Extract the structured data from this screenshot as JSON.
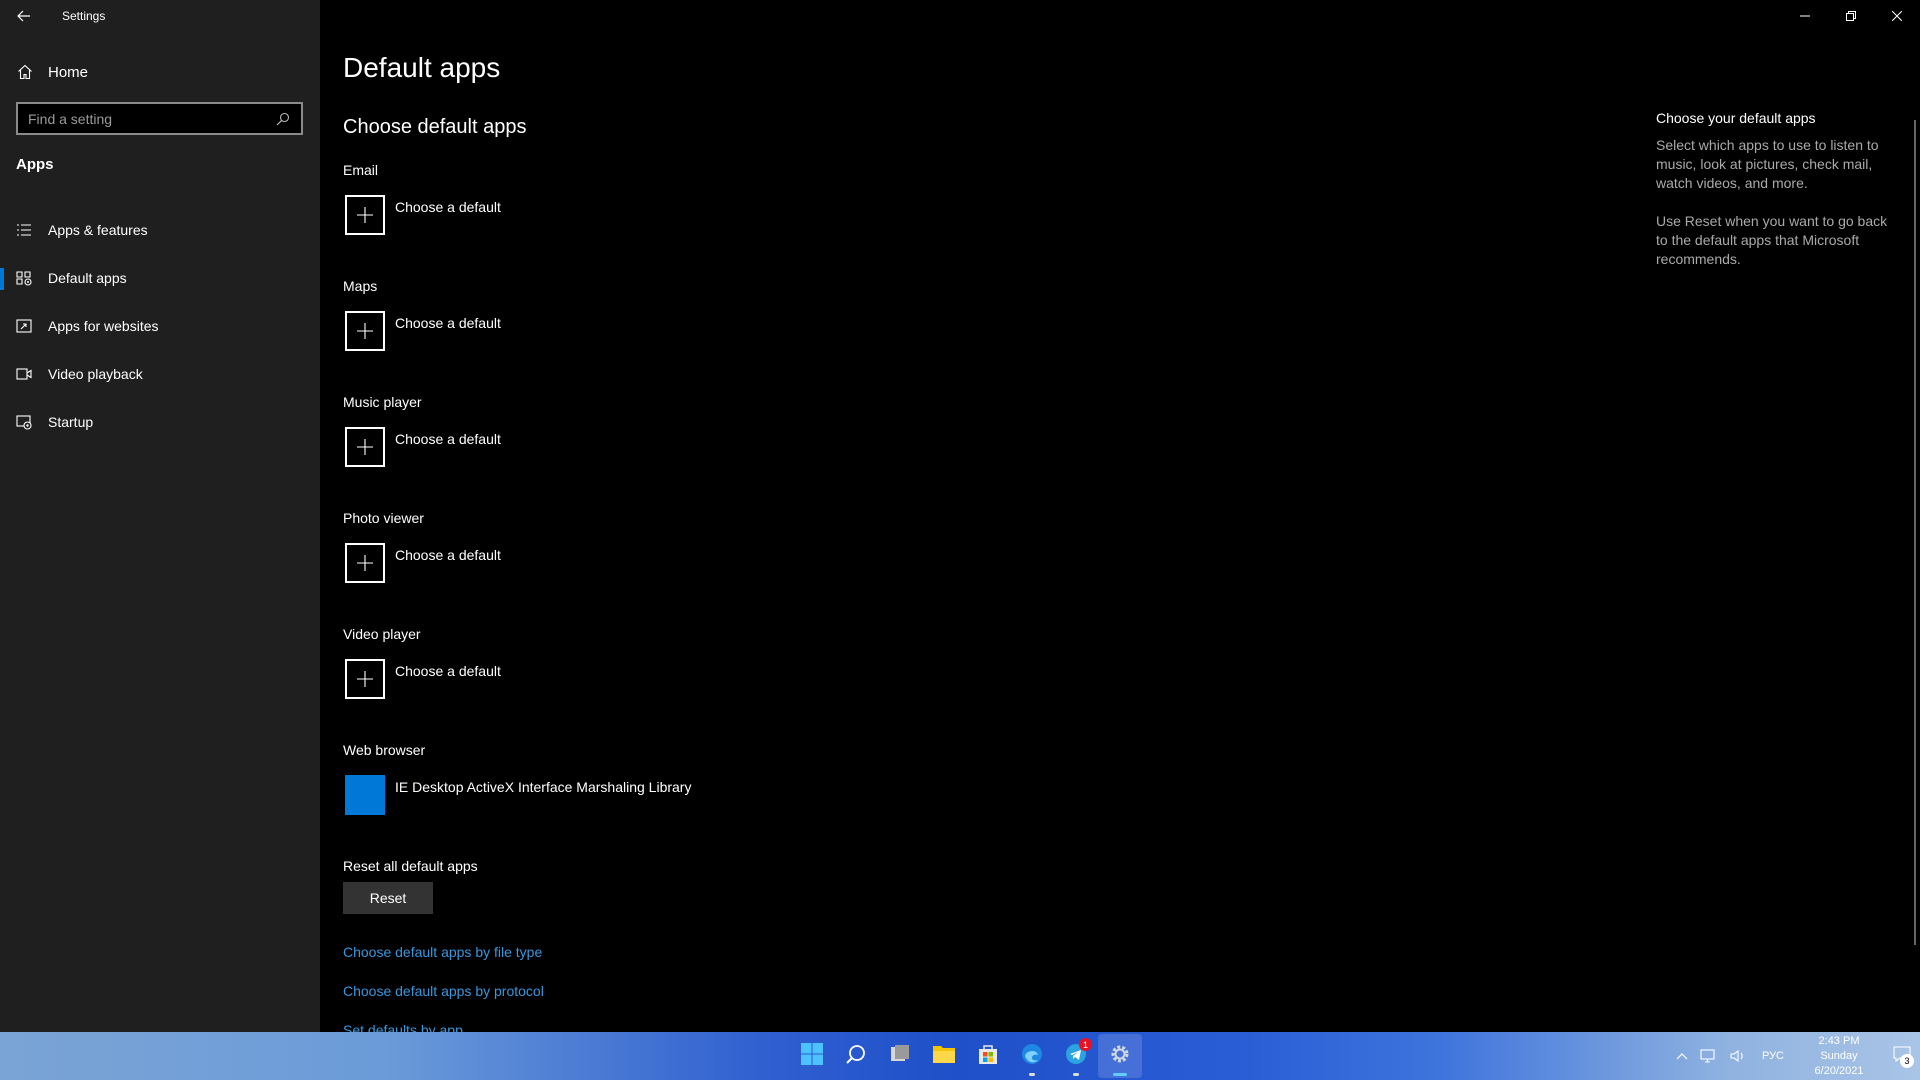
{
  "window": {
    "title": "Settings"
  },
  "sidebar": {
    "home_label": "Home",
    "search_placeholder": "Find a setting",
    "section_heading": "Apps",
    "items": [
      {
        "label": "Apps & features",
        "icon": "list-icon"
      },
      {
        "label": "Default apps",
        "icon": "default-apps-icon",
        "active": true
      },
      {
        "label": "Apps for websites",
        "icon": "open-link-icon"
      },
      {
        "label": "Video playback",
        "icon": "video-icon"
      },
      {
        "label": "Startup",
        "icon": "startup-icon"
      }
    ]
  },
  "main": {
    "title": "Default apps",
    "subtitle": "Choose default apps",
    "categories": [
      {
        "label": "Email",
        "value": "Choose a default"
      },
      {
        "label": "Maps",
        "value": "Choose a default"
      },
      {
        "label": "Music player",
        "value": "Choose a default"
      },
      {
        "label": "Photo viewer",
        "value": "Choose a default"
      },
      {
        "label": "Video player",
        "value": "Choose a default"
      },
      {
        "label": "Web browser",
        "value": "IE Desktop ActiveX Interface Marshaling Library"
      }
    ],
    "reset_label": "Reset all default apps",
    "reset_button": "Reset",
    "links": [
      "Choose default apps by file type",
      "Choose default apps by protocol",
      "Set defaults by app"
    ]
  },
  "info_panel": {
    "heading": "Choose your default apps",
    "paragraphs": [
      "Select which apps to use to listen to music, look at pictures, check mail, watch videos, and more.",
      "Use Reset when you want to go back to the default apps that Microsoft recommends."
    ]
  },
  "taskbar": {
    "apps": [
      "start-icon",
      "search-icon",
      "task-view-icon",
      "file-explorer-icon",
      "store-icon",
      "edge-icon",
      "telegram-icon",
      "settings-icon"
    ],
    "telegram_badge": "1",
    "language": "РУС",
    "time": "2:43 PM",
    "day": "Sunday",
    "date": "6/20/2021",
    "notification_count": "3"
  },
  "colors": {
    "accent": "#0078d7",
    "link": "#3a96dd",
    "sidebar_bg": "#1f1f1f",
    "main_bg": "#000000"
  }
}
